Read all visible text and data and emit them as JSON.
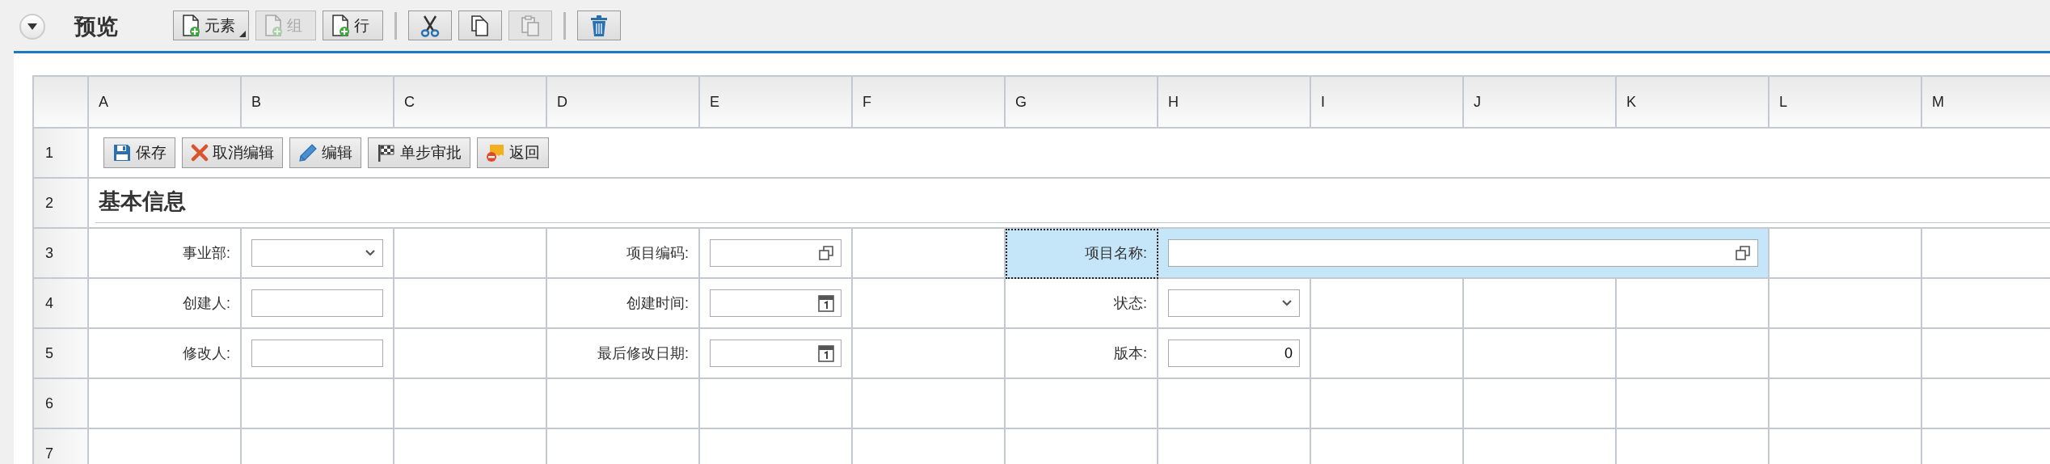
{
  "header": {
    "title": "预览"
  },
  "toolbar": [
    {
      "kind": "add",
      "label": "元素",
      "disabled": false,
      "menu": true
    },
    {
      "kind": "add",
      "label": "组",
      "disabled": true,
      "menu": false
    },
    {
      "kind": "add",
      "label": "行",
      "disabled": false,
      "menu": false
    },
    {
      "kind": "separator"
    },
    {
      "kind": "cut",
      "disabled": false,
      "menu": false
    },
    {
      "kind": "copy",
      "disabled": false,
      "menu": false
    },
    {
      "kind": "paste",
      "disabled": true,
      "menu": false
    },
    {
      "kind": "separator"
    },
    {
      "kind": "delete",
      "disabled": false,
      "menu": false
    }
  ],
  "columns": [
    "A",
    "B",
    "C",
    "D",
    "E",
    "F",
    "G",
    "H",
    "I",
    "J",
    "K",
    "L",
    "M"
  ],
  "row_numbers": [
    "1",
    "2",
    "3",
    "4",
    "5",
    "6",
    "7"
  ],
  "form_buttons": [
    {
      "kind": "save",
      "label": "保存"
    },
    {
      "kind": "cancel",
      "label": "取消编辑"
    },
    {
      "kind": "edit",
      "label": "编辑"
    },
    {
      "kind": "approve",
      "label": "单步审批"
    },
    {
      "kind": "back",
      "label": "返回"
    }
  ],
  "section_title": "基本信息",
  "form_rows": [
    {
      "cells": [
        {
          "kind": "label",
          "text": "事业部:",
          "selected": false,
          "highlighted": false
        },
        {
          "kind": "select",
          "selected": false,
          "highlighted": false
        },
        {
          "kind": "empty",
          "selected": false,
          "highlighted": false
        },
        {
          "kind": "label",
          "text": "项目编码:",
          "selected": false,
          "highlighted": false
        },
        {
          "kind": "lookup",
          "selected": false,
          "highlighted": false
        },
        {
          "kind": "empty",
          "selected": false,
          "highlighted": false
        },
        {
          "kind": "label",
          "text": "项目名称:",
          "selected": true,
          "highlighted": true
        },
        {
          "kind": "wide_lookup",
          "selected": false,
          "highlighted": true
        },
        {
          "kind": "empty",
          "selected": false,
          "highlighted": false
        },
        {
          "kind": "empty",
          "selected": false,
          "highlighted": false
        }
      ]
    },
    {
      "cells": [
        {
          "kind": "label",
          "text": "创建人:",
          "selected": false,
          "highlighted": false
        },
        {
          "kind": "text",
          "selected": false,
          "highlighted": false
        },
        {
          "kind": "empty",
          "selected": false,
          "highlighted": false
        },
        {
          "kind": "label",
          "text": "创建时间:",
          "selected": false,
          "highlighted": false
        },
        {
          "kind": "date",
          "selected": false,
          "highlighted": false
        },
        {
          "kind": "empty",
          "selected": false,
          "highlighted": false
        },
        {
          "kind": "label",
          "text": "状态:",
          "selected": false,
          "highlighted": false
        },
        {
          "kind": "select",
          "selected": false,
          "highlighted": false
        },
        {
          "kind": "empty",
          "selected": false,
          "highlighted": false
        },
        {
          "kind": "empty",
          "selected": false,
          "highlighted": false
        },
        {
          "kind": "empty",
          "selected": false,
          "highlighted": false
        },
        {
          "kind": "empty",
          "selected": false,
          "highlighted": false
        },
        {
          "kind": "empty",
          "selected": false,
          "highlighted": false
        }
      ]
    },
    {
      "cells": [
        {
          "kind": "label",
          "text": "修改人:",
          "selected": false,
          "highlighted": false
        },
        {
          "kind": "text",
          "selected": false,
          "highlighted": false
        },
        {
          "kind": "empty",
          "selected": false,
          "highlighted": false
        },
        {
          "kind": "label",
          "text": "最后修改日期:",
          "selected": false,
          "highlighted": false
        },
        {
          "kind": "date",
          "selected": false,
          "highlighted": false
        },
        {
          "kind": "empty",
          "selected": false,
          "highlighted": false
        },
        {
          "kind": "label",
          "text": "版本:",
          "selected": false,
          "highlighted": false
        },
        {
          "kind": "number",
          "value": "0",
          "selected": false,
          "highlighted": false
        },
        {
          "kind": "empty",
          "selected": false,
          "highlighted": false
        },
        {
          "kind": "empty",
          "selected": false,
          "highlighted": false
        },
        {
          "kind": "empty",
          "selected": false,
          "highlighted": false
        },
        {
          "kind": "empty",
          "selected": false,
          "highlighted": false
        },
        {
          "kind": "empty",
          "selected": false,
          "highlighted": false
        }
      ]
    }
  ]
}
